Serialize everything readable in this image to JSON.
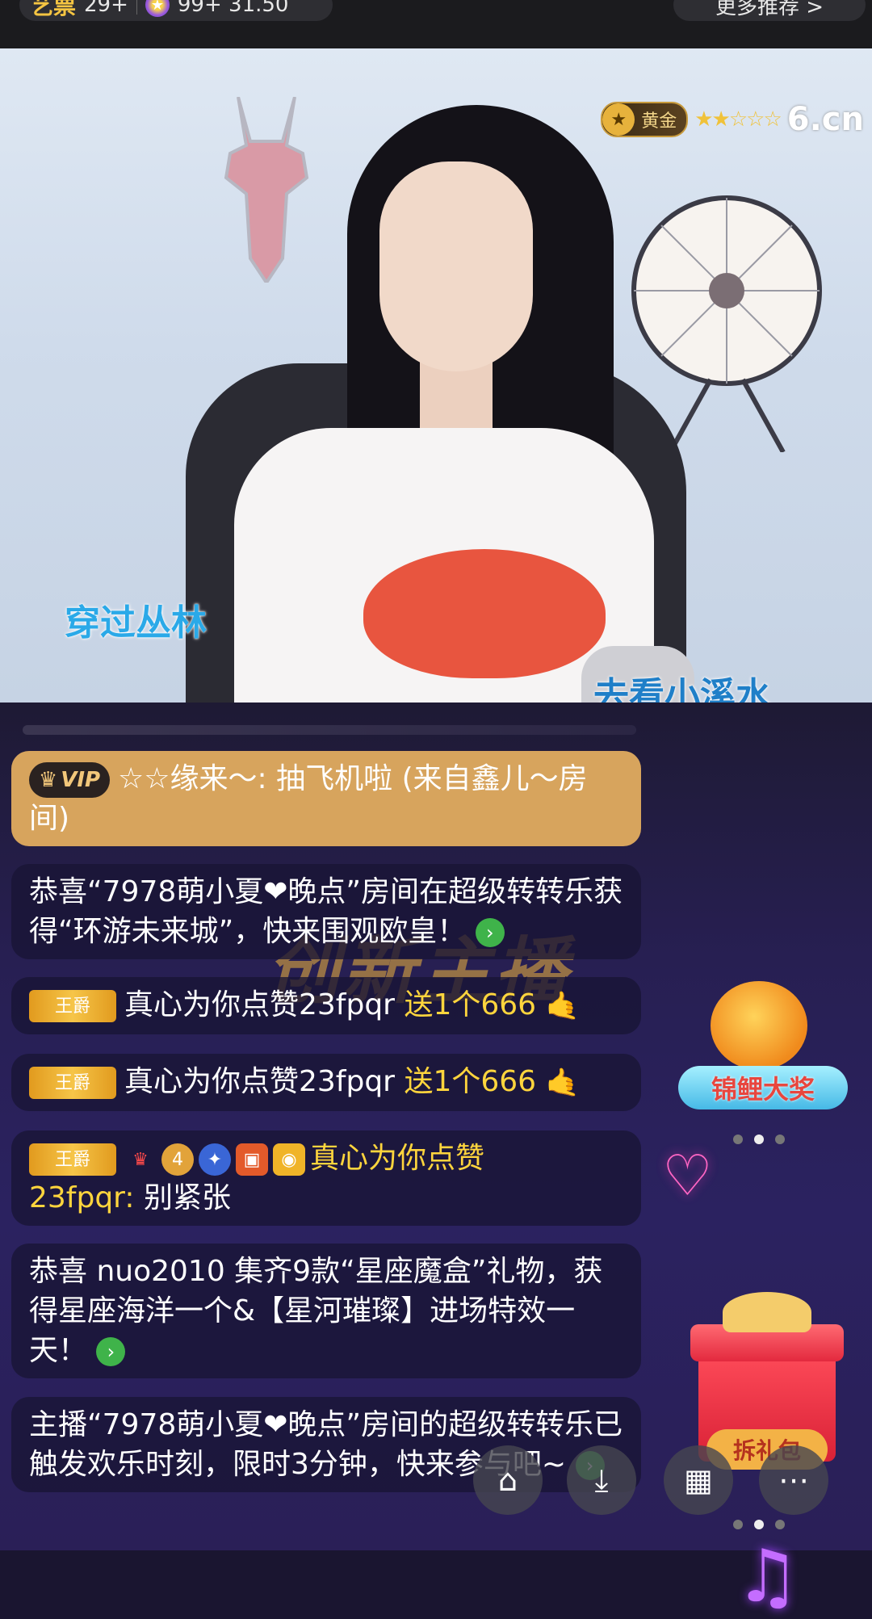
{
  "topbar": {
    "brand": "艺票",
    "count_left": "29+",
    "count_right": "99+ 31.50",
    "more_label": "更多推荐 >"
  },
  "video": {
    "level_label": "黄金",
    "site": "6.cn",
    "lyric_1": "穿过丛林",
    "lyric_2": "去看小溪水"
  },
  "chat": {
    "promo_text": "创新主播",
    "messages": [
      {
        "badge": "VIP",
        "text": "☆☆缘来～: 抽飞机啦 (来自鑫儿～房间)"
      },
      {
        "text": "恭喜“7978萌小夏❤晚点”房间在超级转转乐获得“环游未来城”，快来围观欧皇！"
      },
      {
        "rank": "王爵",
        "text": "真心为你点赞23fpqr",
        "gift": "送1个666"
      },
      {
        "rank": "王爵",
        "text": "真心为你点赞23fpqr",
        "gift": "送1个666"
      },
      {
        "rank": "王爵",
        "name": "真心为你点赞",
        "user": "23fpqr:",
        "text": "别紧张"
      },
      {
        "text": "恭喜 nuo2010 集齐9款“星座魔盒”礼物，获得星座海洋一个&【星河璀璨】进场特效一天！"
      },
      {
        "text": "主播“7978萌小夏❤晚点”房间的超级转转乐已触发欢乐时刻，限时3分钟，快来参与吧~"
      }
    ]
  },
  "widgets": {
    "koi_label": "锦鲤大奖",
    "gift_label": "拆礼包"
  },
  "icons": {
    "go": "arrow-right-icon",
    "share": "share-icon",
    "download": "download-icon",
    "grid": "grid-icon",
    "more": "more-icon"
  }
}
